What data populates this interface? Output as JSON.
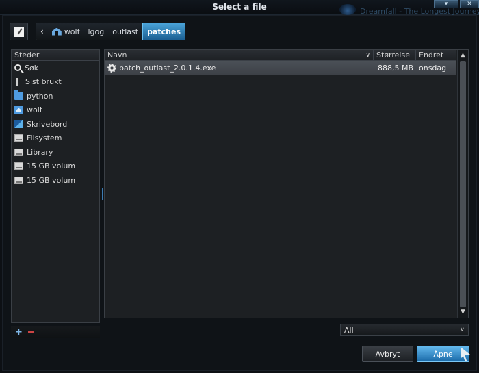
{
  "window": {
    "title": "Select a file",
    "background_title": "Dreamfall - The Longest Journey"
  },
  "pathbar": {
    "crumbs": [
      "wolf",
      "lgog",
      "outlast"
    ],
    "active": "patches"
  },
  "places": {
    "header": "Steder",
    "items": [
      {
        "label": "Søk",
        "icon": "search-icon"
      },
      {
        "label": "Sist brukt",
        "icon": "recent-icon"
      },
      {
        "label": "python",
        "icon": "folder-icon"
      },
      {
        "label": "wolf",
        "icon": "home-folder-icon"
      },
      {
        "label": "Skrivebord",
        "icon": "desktop-icon"
      },
      {
        "label": "Filsystem",
        "icon": "drive-icon"
      },
      {
        "label": "Library",
        "icon": "drive-icon"
      },
      {
        "label": "15 GB volum",
        "icon": "drive-icon"
      },
      {
        "label": "15 GB volum",
        "icon": "drive-icon"
      }
    ]
  },
  "files": {
    "columns": {
      "name": "Navn",
      "size": "Størrelse",
      "modified": "Endret"
    },
    "rows": [
      {
        "name": "patch_outlast_2.0.1.4.exe",
        "size": "888,5 MB",
        "modified": "onsdag"
      }
    ]
  },
  "filter": {
    "value": "All"
  },
  "buttons": {
    "cancel": "Avbryt",
    "open": "Åpne"
  },
  "colors": {
    "accent": "#2f8fd6",
    "background": "#0d1014"
  }
}
